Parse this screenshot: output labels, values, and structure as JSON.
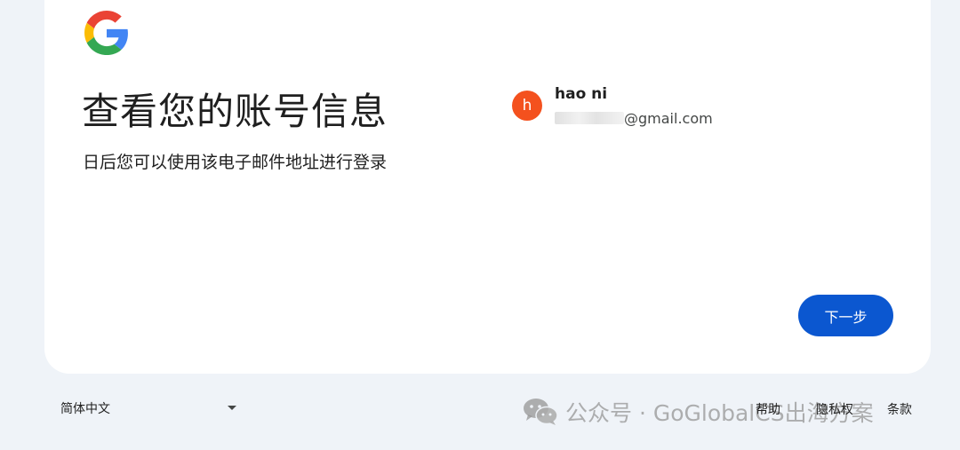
{
  "page": {
    "title": "查看您的账号信息",
    "subtitle": "日后您可以使用该电子邮件地址进行登录"
  },
  "account": {
    "avatar_letter": "h",
    "avatar_color": "#f4511e",
    "name": "hao ni",
    "email_visible_suffix": "@gmail.com"
  },
  "actions": {
    "next_label": "下一步",
    "next_color": "#0b57d0"
  },
  "footer": {
    "language": "简体中文",
    "links": [
      "帮助",
      "隐私权",
      "条款"
    ]
  },
  "watermark": {
    "text": "公众号 · GoGlobalCS出海方案"
  },
  "icons": {
    "logo": "google-logo-icon",
    "dropdown": "caret-down-icon",
    "watermark": "wechat-icon"
  }
}
